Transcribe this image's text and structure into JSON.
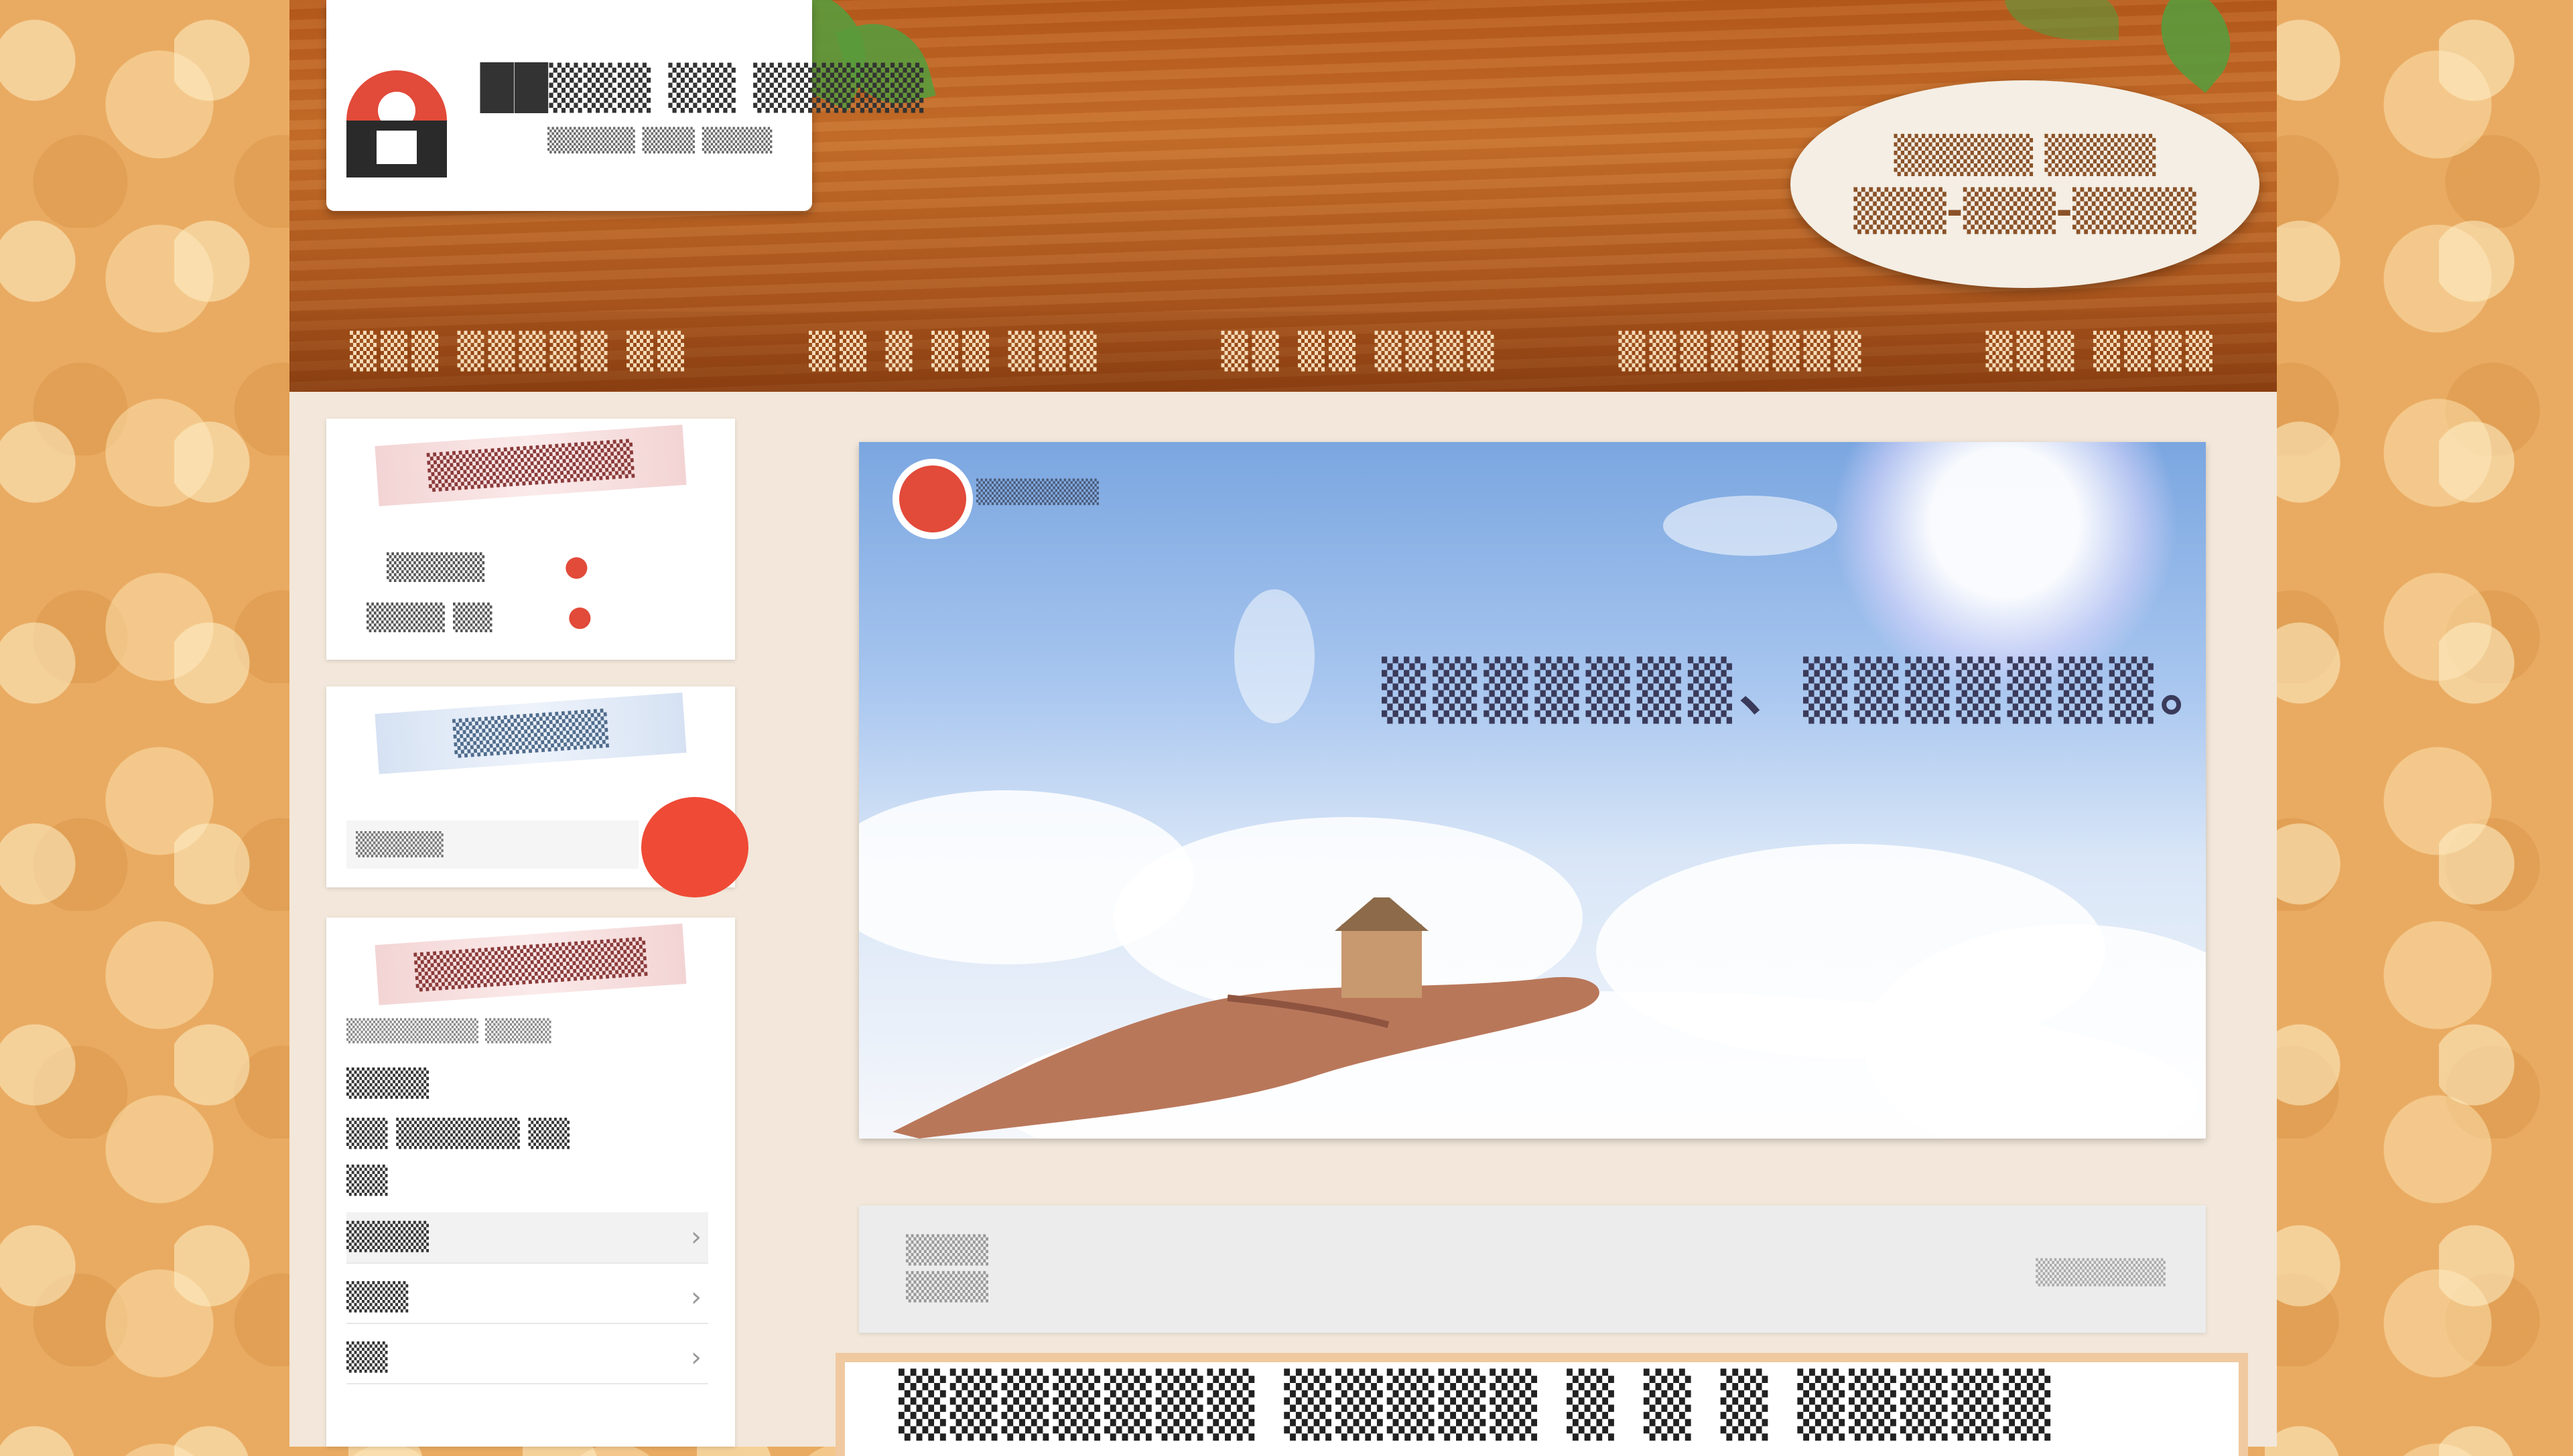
{
  "header": {
    "logo_text": "██▒▒▒ ▒▒ ▒▒▒▒▒",
    "logo_sub": "▒▒▒▒▒ ▒▒▒ ▒▒▒▒",
    "contact_line1": "▒▒▒▒▒ ▒▒▒▒",
    "contact_line2": "▒▒▒-▒▒▒-▒▒▒▒"
  },
  "nav": {
    "items": [
      {
        "label": "▒▒▒ ▒▒▒▒▒ ▒▒"
      },
      {
        "label": "▒▒ ▒ ▒▒ ▒▒▒"
      },
      {
        "label": "▒▒ ▒▒ ▒▒▒▒"
      },
      {
        "label": "▒▒▒▒▒▒▒▒"
      },
      {
        "label": "▒▒▒ ▒▒▒▒"
      }
    ]
  },
  "sidebar": {
    "widget1": {
      "title": "▒▒▒▒▒▒▒▒",
      "line1": "▒▒▒▒▒",
      "line2": "▒▒▒▒ ▒▒",
      "mark1": "●",
      "mark2": "●"
    },
    "widget2": {
      "title": "▒▒▒▒▒▒",
      "search_placeholder": "▒▒▒▒▒"
    },
    "widget3": {
      "title": "▒▒▒▒▒▒▒▒▒",
      "line1": "▒▒▒▒▒▒▒▒ ▒▒▒▒",
      "line2": "▒▒▒▒",
      "line3": "▒▒ ▒▒▒▒▒▒ ▒▒",
      "line4": "▒▒",
      "rows": [
        {
          "label": "▒▒▒▒",
          "chev": "›"
        },
        {
          "label": "▒▒▒",
          "chev": "›"
        },
        {
          "label": "▒▒",
          "chev": "›"
        }
      ]
    }
  },
  "hero": {
    "logo_text": "▒▒▒▒▒▒▒",
    "caption": "▒▒▒▒▒▒▒、▒▒▒▒▒▒▒。"
  },
  "info_bar": {
    "left_line1": "▒▒▒▒",
    "left_line2": "▒▒▒▒",
    "right": "▒▒▒▒▒▒▒"
  },
  "post": {
    "title": "▒▒▒▒▒▒▒ ▒▒▒▒▒ ▒ ▒ ▒ ▒▒▒▒▒"
  },
  "colors": {
    "header": "#b75a1c",
    "accent_red": "#e24a3a",
    "page_bg": "#e9ab62"
  }
}
